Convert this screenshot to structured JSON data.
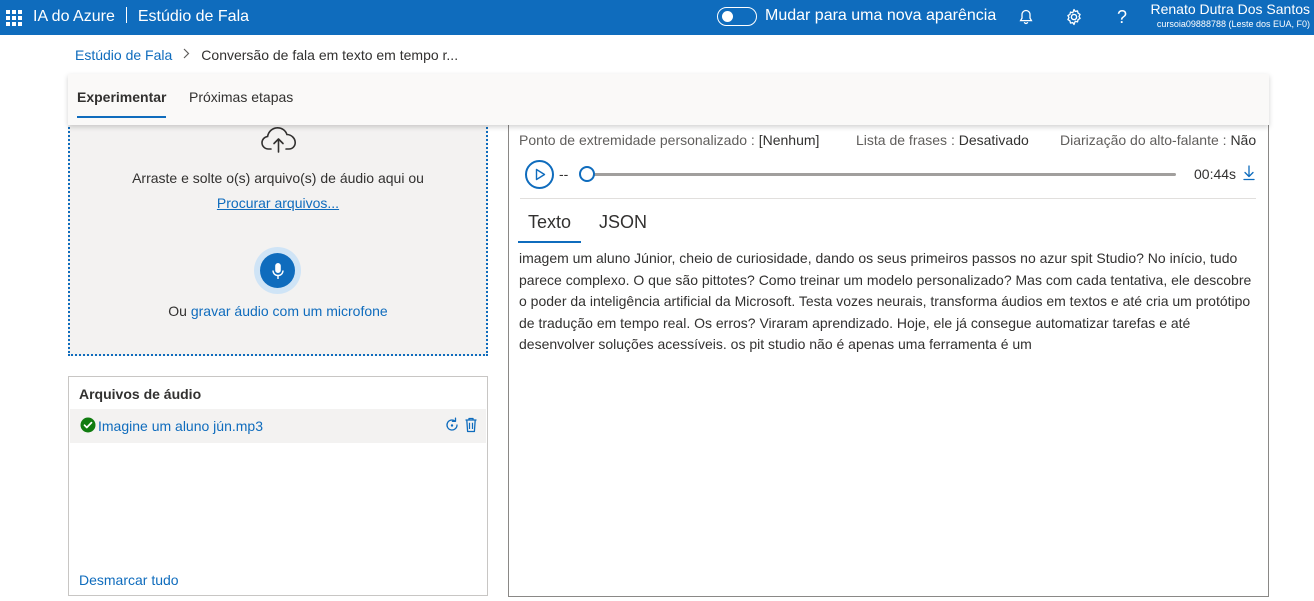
{
  "topbar": {
    "product": "IA do Azure",
    "studio": "Estúdio de Fala",
    "toggle_label": "Mudar para uma nova aparência",
    "help_symbol": "?",
    "user_name": "Renato Dutra Dos Santos",
    "user_account": "cursoia09888788 (Leste dos EUA, F0)",
    "icons": [
      "waffle-icon",
      "bell-icon",
      "gear-icon",
      "help-icon"
    ]
  },
  "breadcrumb": {
    "root": "Estúdio de Fala",
    "current": "Conversão de fala em texto em tempo r..."
  },
  "tabs": [
    {
      "label": "Experimentar",
      "active": true
    },
    {
      "label": "Próximas etapas",
      "active": false
    }
  ],
  "dropzone": {
    "drag_text": "Arraste e solte o(s) arquivo(s) de áudio aqui ou",
    "browse_link": "Procurar arquivos...",
    "mic_prefix": "Ou",
    "mic_link": "gravar áudio com um microfone",
    "icons": [
      "cloud-upload-icon",
      "microphone-icon"
    ]
  },
  "files": {
    "header": "Arquivos de áudio",
    "items": [
      {
        "name": "Imagine um aluno jún.mp3",
        "status": "success"
      }
    ],
    "deselect_all": "Desmarcar tudo"
  },
  "result": {
    "custom_endpoint_label": "Ponto de extremidade personalizado :",
    "custom_endpoint_value": "[Nenhum]",
    "phrase_list_label": "Lista de frases :",
    "phrase_list_value": "Desativado",
    "diarization_label": "Diarização do alto-falante :",
    "diarization_value": "Não",
    "player": {
      "current": "--",
      "duration": "00:44s",
      "progress": 0
    },
    "tabs": [
      {
        "label": "Texto",
        "active": true
      },
      {
        "label": "JSON",
        "active": false
      }
    ],
    "transcript": "imagem um aluno Júnior, cheio de curiosidade, dando os seus primeiros passos no azur spit Studio? No início, tudo parece complexo. O que são pittotes? Como treinar um modelo personalizado? Mas com cada tentativa, ele descobre o poder da inteligência artificial da Microsoft. Testa vozes neurais, transforma áudios em textos e até cria um protótipo de tradução em tempo real. Os erros? Viraram aprendizado. Hoje, ele já consegue automatizar tarefas e até desenvolver soluções acessíveis. os pit studio não é apenas uma ferramenta é um"
  },
  "colors": {
    "accent": "#0f6cbd",
    "success": "#107c10",
    "topbar_bg": "#0f6cbd"
  }
}
